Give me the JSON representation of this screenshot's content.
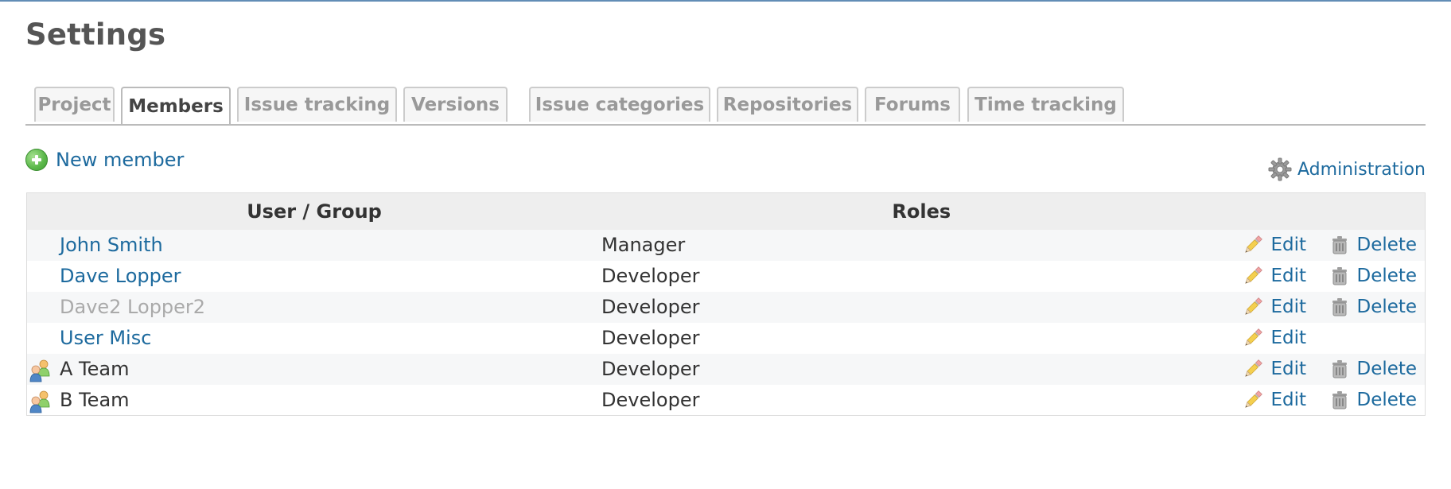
{
  "page": {
    "title": "Settings"
  },
  "tabs": [
    {
      "label": "Project",
      "selected": false
    },
    {
      "label": "Members",
      "selected": true
    },
    {
      "label": "Issue tracking",
      "selected": false
    },
    {
      "label": "Versions",
      "selected": false
    },
    {
      "label": "Issue categories",
      "selected": false
    },
    {
      "label": "Repositories",
      "selected": false
    },
    {
      "label": "Forums",
      "selected": false
    },
    {
      "label": "Time tracking",
      "selected": false
    }
  ],
  "toolbar": {
    "new_member_label": "New member",
    "administration_label": "Administration"
  },
  "table": {
    "headers": {
      "user_group": "User / Group",
      "roles": "Roles"
    },
    "rows": [
      {
        "name": "John Smith",
        "type": "user",
        "status": "active",
        "role": "Manager",
        "edit_label": "Edit",
        "delete_label": "Delete"
      },
      {
        "name": "Dave Lopper",
        "type": "user",
        "status": "active",
        "role": "Developer",
        "edit_label": "Edit",
        "delete_label": "Delete"
      },
      {
        "name": "Dave2 Lopper2",
        "type": "user",
        "status": "locked",
        "role": "Developer",
        "edit_label": "Edit",
        "delete_label": "Delete"
      },
      {
        "name": "User Misc",
        "type": "user",
        "status": "active",
        "role": "Developer",
        "edit_label": "Edit",
        "delete_label": ""
      },
      {
        "name": "A Team",
        "type": "group",
        "status": "active",
        "role": "Developer",
        "edit_label": "Edit",
        "delete_label": "Delete"
      },
      {
        "name": "B Team",
        "type": "group",
        "status": "active",
        "role": "Developer",
        "edit_label": "Edit",
        "delete_label": "Delete"
      }
    ]
  },
  "icons": {
    "new_member": "add-icon",
    "administration": "gear-icon",
    "edit": "pencil-icon",
    "delete": "trash-icon",
    "group": "group-icon"
  },
  "colors": {
    "link": "#1d6a9e",
    "locked": "#aaaaaa",
    "topline": "#628db6"
  }
}
